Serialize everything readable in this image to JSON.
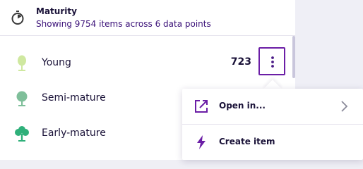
{
  "header": {
    "title": "Maturity",
    "subtitle": "Showing 9754 items across 6 data points",
    "icon": "stopwatch-icon"
  },
  "rows": [
    {
      "label": "Young",
      "count": "723",
      "icon": "young-tree-icon",
      "color": "#cfe8a0"
    },
    {
      "label": "Semi-mature",
      "icon": "semi-mature-tree-icon",
      "color": "#7fbf9a"
    },
    {
      "label": "Early-mature",
      "icon": "early-mature-tree-icon",
      "color": "#2fb07a"
    }
  ],
  "actions": {
    "more_icon": "more-vertical-icon"
  },
  "menu": {
    "items": [
      {
        "label": "Open in...",
        "icon": "external-link-icon",
        "trailing_icon": "chevron-right-icon"
      },
      {
        "label": "Create item",
        "icon": "lightning-icon"
      }
    ]
  },
  "colors": {
    "accent": "#6b1ea6",
    "text": "#1a1238",
    "subtitle": "#3a1078"
  }
}
